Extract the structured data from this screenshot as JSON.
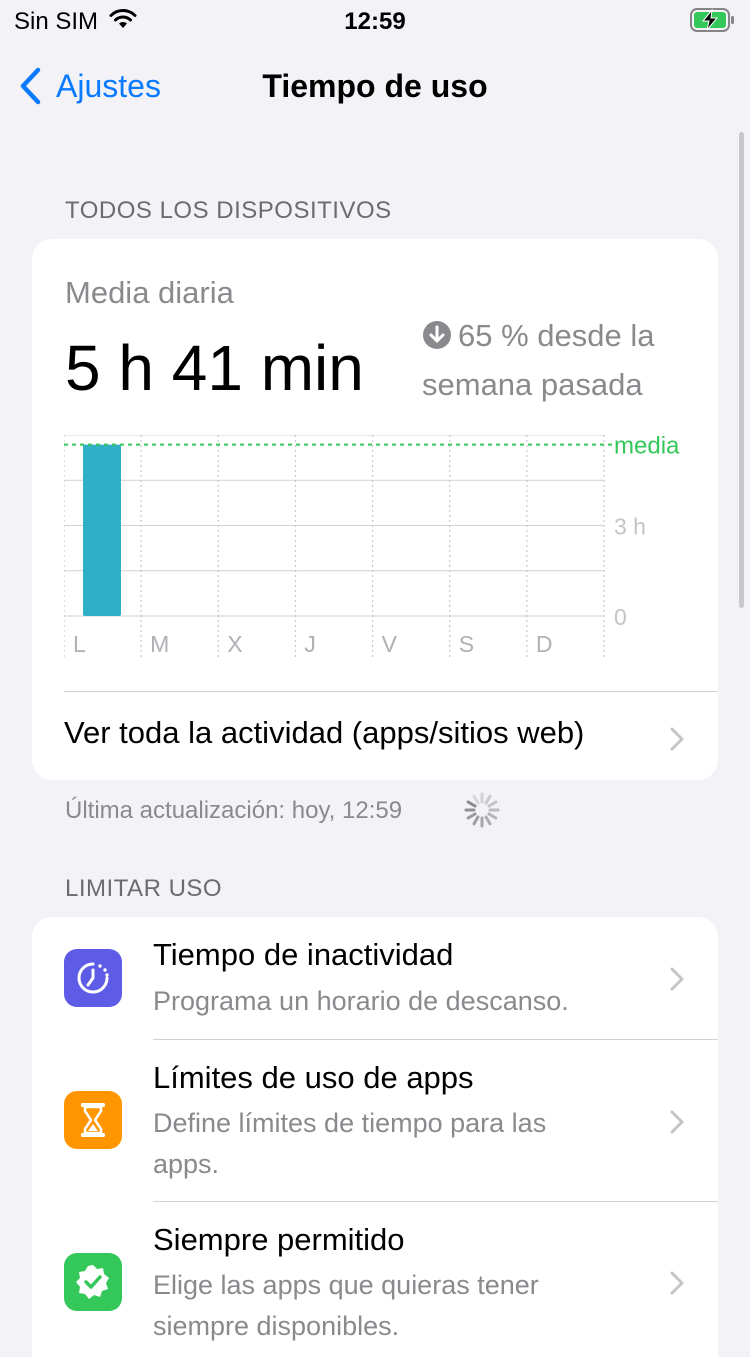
{
  "status_bar": {
    "carrier": "Sin SIM",
    "time": "12:59"
  },
  "nav": {
    "back_label": "Ajustes",
    "title": "Tiempo de uso"
  },
  "all_devices": {
    "header": "TODOS LOS DISPOSITIVOS",
    "average_label": "Media diaria",
    "average_value": "5 h 41 min",
    "change_text": "65 % desde la semana pasada",
    "view_all_label": "Ver toda la actividad (apps/sitios web)"
  },
  "chart_data": {
    "type": "bar",
    "categories": [
      "L",
      "M",
      "X",
      "J",
      "V",
      "S",
      "D"
    ],
    "values": [
      5.68,
      0,
      0,
      0,
      0,
      0,
      0
    ],
    "average": 5.68,
    "average_label": "media",
    "y_ticks": [
      {
        "value": 3,
        "label": "3 h"
      },
      {
        "value": 0,
        "label": "0"
      }
    ],
    "ylim": [
      0,
      6
    ],
    "bar_color": "#30b0c7",
    "average_color": "#34c759"
  },
  "last_update": "Última actualización: hoy, 12:59",
  "limit_usage": {
    "header": "LIMITAR USO",
    "items": [
      {
        "title": "Tiempo de inactividad",
        "subtitle": "Programa un horario de descanso.",
        "icon": "downtime-icon",
        "color": "#5e5ce6"
      },
      {
        "title": "Límites de uso de apps",
        "subtitle": "Define límites de tiempo para las apps.",
        "icon": "hourglass-icon",
        "color": "#ff9500"
      },
      {
        "title": "Siempre permitido",
        "subtitle": "Elige las apps que quieras tener siempre disponibles.",
        "icon": "checkmark-seal-icon",
        "color": "#34c759"
      }
    ]
  }
}
